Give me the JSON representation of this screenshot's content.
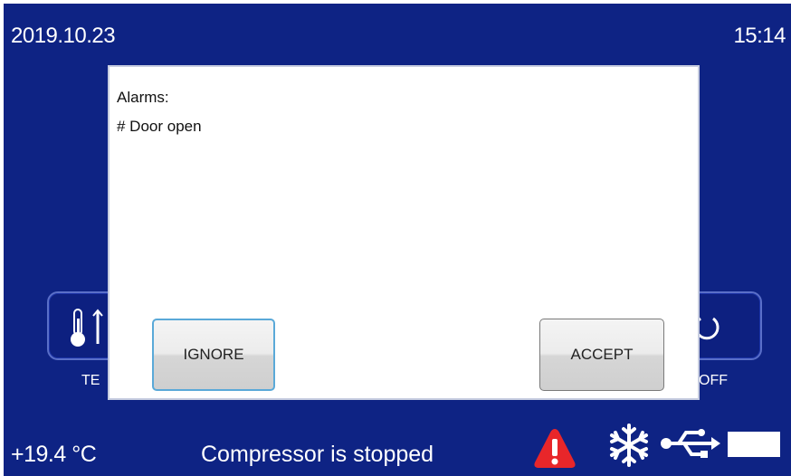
{
  "header": {
    "date": "2019.10.23",
    "time": "15:14"
  },
  "background": {
    "temp_button_label_partial": "TE",
    "power_button_label_partial": "OFF"
  },
  "dialog": {
    "title": "Alarms:",
    "items": [
      "# Door open"
    ],
    "ignore_label": "IGNORE",
    "accept_label": "ACCEPT"
  },
  "status_bar": {
    "temperature": "+19.4 °C",
    "compressor": "Compressor is stopped",
    "icons": [
      "alarm-warning-icon",
      "snowflake-icon",
      "usb-icon",
      "battery-icon"
    ]
  },
  "colors": {
    "screen_bg": "#0e2384",
    "alarm_red": "#e8262a",
    "dialog_bg": "#ffffff",
    "ignore_border": "#5aa9d8"
  }
}
